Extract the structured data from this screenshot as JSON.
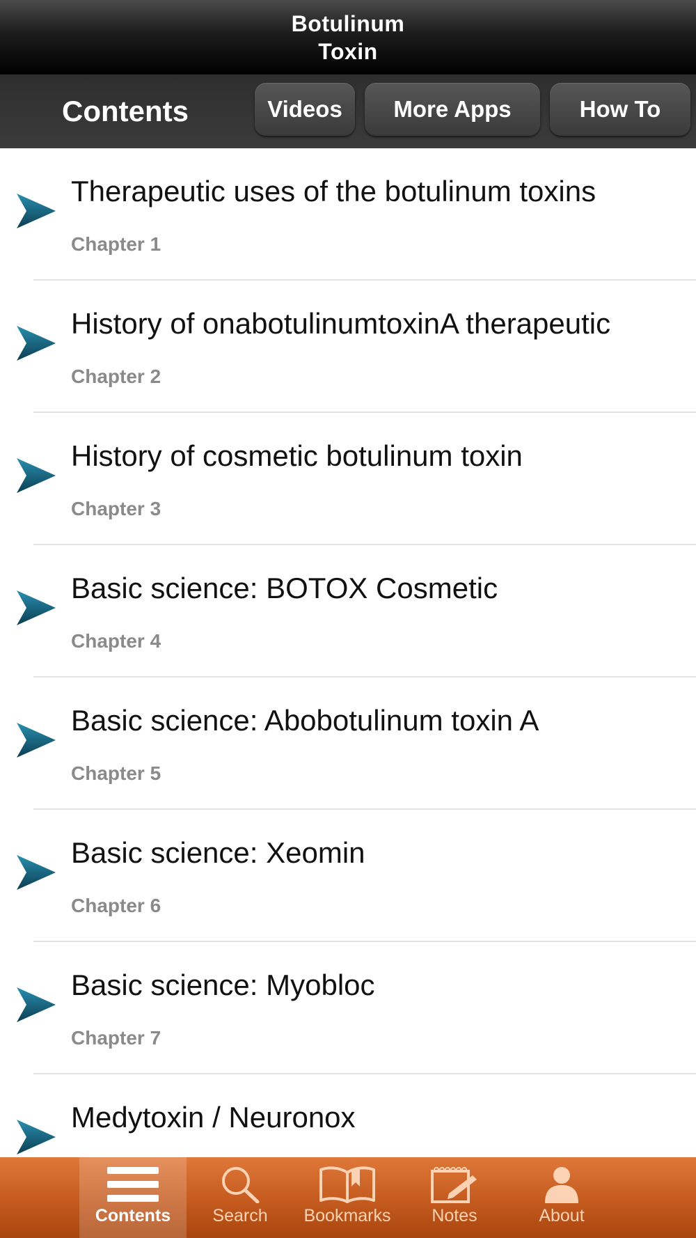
{
  "app": {
    "title_line1": "Botulinum",
    "title_line2": "Toxin"
  },
  "segment": {
    "current": "Contents",
    "buttons": [
      "Videos",
      "More Apps",
      "How To"
    ]
  },
  "chapters": [
    {
      "title": "Therapeutic uses of the botulinum toxins",
      "subtitle": "Chapter 1"
    },
    {
      "title": "History of onabotulinumtoxinA therapeutic",
      "subtitle": "Chapter 2"
    },
    {
      "title": "History of cosmetic botulinum toxin",
      "subtitle": "Chapter 3"
    },
    {
      "title": "Basic science: BOTOX Cosmetic",
      "subtitle": "Chapter 4"
    },
    {
      "title": "Basic science: Abobotulinum toxin A",
      "subtitle": "Chapter 5"
    },
    {
      "title": "Basic science: Xeomin",
      "subtitle": "Chapter 6"
    },
    {
      "title": "Basic science: Myobloc",
      "subtitle": "Chapter 7"
    },
    {
      "title": "Medytoxin / Neuronox",
      "subtitle": ""
    }
  ],
  "tabs": [
    {
      "label": "Contents",
      "icon": "menu-icon",
      "active": true
    },
    {
      "label": "Search",
      "icon": "search-icon",
      "active": false
    },
    {
      "label": "Bookmarks",
      "icon": "book-icon",
      "active": false
    },
    {
      "label": "Notes",
      "icon": "notepad-icon",
      "active": false
    },
    {
      "label": "About",
      "icon": "person-icon",
      "active": false
    }
  ],
  "colors": {
    "arrow": "#1f6f8f",
    "tabbar": "#c45a1e"
  }
}
